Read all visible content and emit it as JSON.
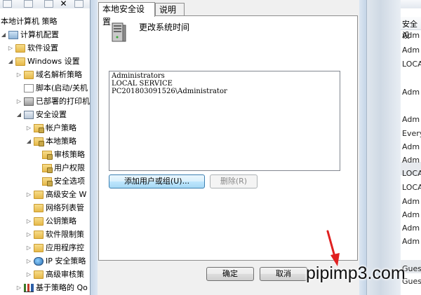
{
  "window": {
    "root_label": "本地计算机 策略",
    "right_header": "安全设"
  },
  "tree": {
    "items": [
      {
        "label": "计算机配置",
        "icon": "computer-icon"
      },
      {
        "label": "软件设置",
        "icon": "folder-icon"
      },
      {
        "label": "Windows 设置",
        "icon": "folder-icon"
      },
      {
        "label": "域名解析策略",
        "icon": "folder-icon"
      },
      {
        "label": "脚本(启动/关机",
        "icon": "script-icon"
      },
      {
        "label": "已部署的打印机",
        "icon": "printer-icon"
      },
      {
        "label": "安全设置",
        "icon": "shield-icon"
      },
      {
        "label": "帐户策略",
        "icon": "folder-lock-icon"
      },
      {
        "label": "本地策略",
        "icon": "folder-lock-icon"
      },
      {
        "label": "审核策略",
        "icon": "folder-lock-icon"
      },
      {
        "label": "用户权限",
        "icon": "folder-lock-icon"
      },
      {
        "label": "安全选项",
        "icon": "folder-lock-icon"
      },
      {
        "label": "高级安全 W",
        "icon": "folder-icon"
      },
      {
        "label": "网络列表管",
        "icon": "folder-icon"
      },
      {
        "label": "公钥策略",
        "icon": "folder-icon"
      },
      {
        "label": "软件限制策",
        "icon": "folder-icon"
      },
      {
        "label": "应用程序控",
        "icon": "folder-icon"
      },
      {
        "label": "IP 安全策略",
        "icon": "globe-icon"
      },
      {
        "label": "高级审核策",
        "icon": "folder-icon"
      },
      {
        "label": "基于策略的 Qo",
        "icon": "chart-icon"
      }
    ]
  },
  "right_column": {
    "cells": [
      "Adm",
      "Adm",
      "LOCA",
      "Adm",
      "Adm",
      "Every",
      "Adm",
      "Adm",
      "LOCA",
      "LOCA",
      "Adm",
      "Adm",
      "Adm",
      "Adm",
      "Gues",
      "Gues"
    ]
  },
  "dialog": {
    "tabs": [
      {
        "label": "本地安全设置",
        "active": true
      },
      {
        "label": "说明",
        "active": false
      }
    ],
    "policy_icon": "server-icon",
    "policy_title": "更改系统时间",
    "principals": [
      "Administrators",
      "LOCAL SERVICE",
      "PC201803091526\\Administrator"
    ],
    "add_button": "添加用户或组(U)...",
    "remove_button": "删除(R)",
    "ok_button": "确定",
    "cancel_button": "取消"
  },
  "watermark": "pipimp3.com",
  "colors": {
    "accent_arrow": "#e02020",
    "dialog_bg": "#f0f0f0",
    "focus_border": "#3c7fb1"
  }
}
